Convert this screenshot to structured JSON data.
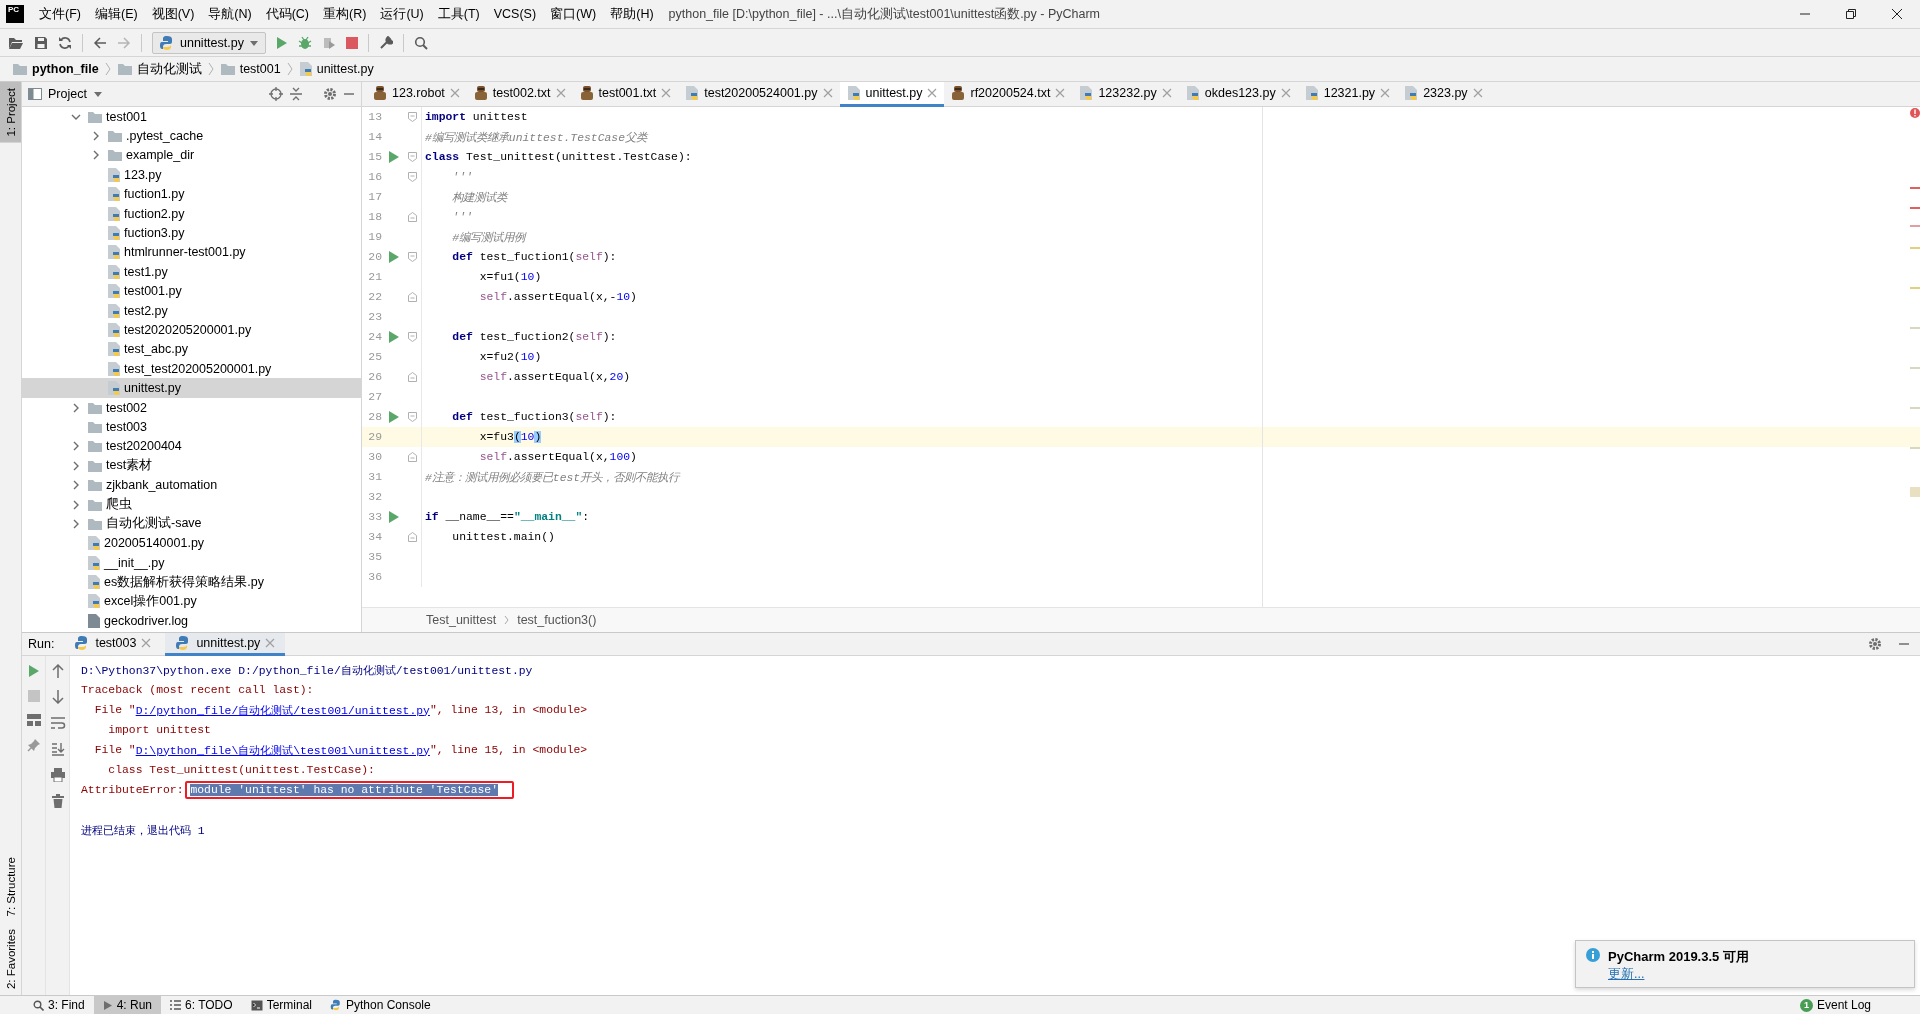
{
  "window": {
    "logo": "PC",
    "title": "python_file [D:\\python_file] - ...\\自动化测试\\test001\\unittest函数.py - PyCharm"
  },
  "menu": [
    "文件(F)",
    "编辑(E)",
    "视图(V)",
    "导航(N)",
    "代码(C)",
    "重构(R)",
    "运行(U)",
    "工具(T)",
    "VCS(S)",
    "窗口(W)",
    "帮助(H)"
  ],
  "toolbar": {
    "run_config": "unnittest.py"
  },
  "navigation": [
    "python_file",
    "自动化测试",
    "test001",
    "unittest.py"
  ],
  "side_stripe": [
    {
      "label": "1: Project",
      "selected": true
    },
    {
      "label": "7: Structure",
      "selected": false
    },
    {
      "label": "2: Favorites",
      "selected": false
    }
  ],
  "project": {
    "title": "Project",
    "tree": [
      {
        "name": "test001",
        "kind": "folder",
        "expanded": true,
        "selected": false,
        "children": [
          {
            "name": ".pytest_cache",
            "kind": "folder",
            "expanded": false,
            "selected": false
          },
          {
            "name": "example_dir",
            "kind": "folder",
            "expanded": false,
            "selected": false
          },
          {
            "name": "123.py",
            "kind": "python",
            "selected": false
          },
          {
            "name": "fuction1.py",
            "kind": "python",
            "selected": false
          },
          {
            "name": "fuction2.py",
            "kind": "python",
            "selected": false
          },
          {
            "name": "fuction3.py",
            "kind": "python",
            "selected": false
          },
          {
            "name": "htmlrunner-test001.py",
            "kind": "python",
            "selected": false
          },
          {
            "name": "test1.py",
            "kind": "python",
            "selected": false
          },
          {
            "name": "test001.py",
            "kind": "python",
            "selected": false
          },
          {
            "name": "test2.py",
            "kind": "python",
            "selected": false
          },
          {
            "name": "test2020205200001.py",
            "kind": "python",
            "selected": false
          },
          {
            "name": "test_abc.py",
            "kind": "python",
            "selected": false
          },
          {
            "name": "test_test202005200001.py",
            "kind": "python",
            "selected": false
          },
          {
            "name": "unittest.py",
            "kind": "python",
            "selected": true
          }
        ]
      },
      {
        "name": "test002",
        "kind": "folder",
        "expanded": false,
        "selected": false
      },
      {
        "name": "test003",
        "kind": "folder",
        "selected": false
      },
      {
        "name": "test20200404",
        "kind": "folder",
        "expanded": false,
        "selected": false
      },
      {
        "name": "test素材",
        "kind": "folder",
        "expanded": false,
        "selected": false
      },
      {
        "name": "zjkbank_automation",
        "kind": "folder",
        "expanded": false,
        "selected": false
      },
      {
        "name": "爬虫",
        "kind": "folder",
        "expanded": false,
        "selected": false
      },
      {
        "name": "自动化测试-save",
        "kind": "folder",
        "expanded": false,
        "selected": false
      },
      {
        "name": "202005140001.py",
        "kind": "python",
        "selected": false
      },
      {
        "name": "__init__.py",
        "kind": "python",
        "selected": false
      },
      {
        "name": "es数据解析获得策略结果.py",
        "kind": "python",
        "selected": false
      },
      {
        "name": "excel操作001.py",
        "kind": "python",
        "selected": false
      },
      {
        "name": "geckodriver.log",
        "kind": "log",
        "selected": false
      }
    ]
  },
  "editor": {
    "tabs": [
      {
        "label": "123.robot",
        "kind": "robot",
        "selected": false
      },
      {
        "label": "test002.txt",
        "kind": "robot",
        "selected": false
      },
      {
        "label": "test001.txt",
        "kind": "robot",
        "selected": false
      },
      {
        "label": "test20200524001.py",
        "kind": "python",
        "selected": false
      },
      {
        "label": "unittest.py",
        "kind": "python",
        "selected": true
      },
      {
        "label": "rf20200524.txt",
        "kind": "robot",
        "selected": false
      },
      {
        "label": "123232.py",
        "kind": "python",
        "selected": false
      },
      {
        "label": "okdes123.py",
        "kind": "python",
        "selected": false
      },
      {
        "label": "12321.py",
        "kind": "python",
        "selected": false
      },
      {
        "label": "2323.py",
        "kind": "python",
        "selected": false
      }
    ],
    "lines": [
      {
        "number": "13",
        "run": false,
        "fold_start": true,
        "fold_end": false,
        "current": false,
        "tokens": [
          {
            "kind": "keyword",
            "text": "import"
          },
          {
            "kind": "plain",
            "text": " unittest"
          }
        ]
      },
      {
        "number": "14",
        "run": false,
        "fold_start": false,
        "fold_end": false,
        "current": false,
        "tokens": [
          {
            "kind": "comment",
            "text": "#编写测试类继承unittest.TestCase父类"
          }
        ]
      },
      {
        "number": "15",
        "run": true,
        "fold_start": true,
        "fold_end": false,
        "current": false,
        "tokens": [
          {
            "kind": "keyword",
            "text": "class"
          },
          {
            "kind": "plain",
            "text": " Test_unittest(unittest.TestCase):"
          }
        ]
      },
      {
        "number": "16",
        "run": false,
        "fold_start": true,
        "fold_end": false,
        "current": false,
        "tokens": [
          {
            "kind": "comment",
            "text": "    '''"
          }
        ]
      },
      {
        "number": "17",
        "run": false,
        "fold_start": false,
        "fold_end": false,
        "current": false,
        "tokens": [
          {
            "kind": "comment",
            "text": "    构建测试类"
          }
        ]
      },
      {
        "number": "18",
        "run": false,
        "fold_start": false,
        "fold_end": true,
        "current": false,
        "tokens": [
          {
            "kind": "comment",
            "text": "    '''"
          }
        ]
      },
      {
        "number": "19",
        "run": false,
        "fold_start": false,
        "fold_end": false,
        "current": false,
        "tokens": [
          {
            "kind": "comment",
            "text": "    #编写测试用例"
          }
        ]
      },
      {
        "number": "20",
        "run": true,
        "fold_start": true,
        "fold_end": false,
        "current": false,
        "tokens": [
          {
            "kind": "keyword",
            "text": "    def"
          },
          {
            "kind": "plain",
            "text": " test_fuction1("
          },
          {
            "kind": "self",
            "text": "self"
          },
          {
            "kind": "plain",
            "text": "):"
          }
        ]
      },
      {
        "number": "21",
        "run": false,
        "fold_start": false,
        "fold_end": false,
        "current": false,
        "tokens": [
          {
            "kind": "plain",
            "text": "        x=fu1("
          },
          {
            "kind": "number",
            "text": "10"
          },
          {
            "kind": "plain",
            "text": ")"
          }
        ]
      },
      {
        "number": "22",
        "run": false,
        "fold_start": false,
        "fold_end": true,
        "current": false,
        "tokens": [
          {
            "kind": "self",
            "text": "        self"
          },
          {
            "kind": "plain",
            "text": ".assertEqual(x,-"
          },
          {
            "kind": "number",
            "text": "10"
          },
          {
            "kind": "plain",
            "text": ")"
          }
        ]
      },
      {
        "number": "23",
        "run": false,
        "fold_start": false,
        "fold_end": false,
        "current": false
      },
      {
        "number": "24",
        "run": true,
        "fold_start": true,
        "fold_end": false,
        "current": false,
        "tokens": [
          {
            "kind": "keyword",
            "text": "    def"
          },
          {
            "kind": "plain",
            "text": " test_fuction2("
          },
          {
            "kind": "self",
            "text": "self"
          },
          {
            "kind": "plain",
            "text": "):"
          }
        ]
      },
      {
        "number": "25",
        "run": false,
        "fold_start": false,
        "fold_end": false,
        "current": false,
        "tokens": [
          {
            "kind": "plain",
            "text": "        x=fu2("
          },
          {
            "kind": "number",
            "text": "10"
          },
          {
            "kind": "plain",
            "text": ")"
          }
        ]
      },
      {
        "number": "26",
        "run": false,
        "fold_start": false,
        "fold_end": true,
        "current": false,
        "tokens": [
          {
            "kind": "self",
            "text": "        self"
          },
          {
            "kind": "plain",
            "text": ".assertEqual(x,"
          },
          {
            "kind": "number",
            "text": "20"
          },
          {
            "kind": "plain",
            "text": ")"
          }
        ]
      },
      {
        "number": "27",
        "run": false,
        "fold_start": false,
        "fold_end": false,
        "current": false
      },
      {
        "number": "28",
        "run": true,
        "fold_start": true,
        "fold_end": false,
        "current": false,
        "tokens": [
          {
            "kind": "keyword",
            "text": "    def"
          },
          {
            "kind": "plain",
            "text": " test_fuction3("
          },
          {
            "kind": "self",
            "text": "self"
          },
          {
            "kind": "plain",
            "text": "):"
          }
        ]
      },
      {
        "number": "29",
        "run": false,
        "fold_start": false,
        "fold_end": false,
        "current": true,
        "tokens": [
          {
            "kind": "plain",
            "text": "        x=fu3"
          },
          {
            "kind": "bracket",
            "text": "("
          },
          {
            "kind": "number",
            "text": "10"
          },
          {
            "kind": "bracket",
            "text": ")"
          }
        ]
      },
      {
        "number": "30",
        "run": false,
        "fold_start": false,
        "fold_end": true,
        "current": false,
        "tokens": [
          {
            "kind": "self",
            "text": "        self"
          },
          {
            "kind": "plain",
            "text": ".assertEqual(x,"
          },
          {
            "kind": "number",
            "text": "100"
          },
          {
            "kind": "plain",
            "text": ")"
          }
        ]
      },
      {
        "number": "31",
        "run": false,
        "fold_start": false,
        "fold_end": false,
        "current": false,
        "tokens": [
          {
            "kind": "comment",
            "text": "#注意：测试用例必须要已test开头，否则不能执行"
          }
        ]
      },
      {
        "number": "32",
        "run": false,
        "fold_start": false,
        "fold_end": false,
        "current": false
      },
      {
        "number": "33",
        "run": true,
        "fold_start": false,
        "fold_end": false,
        "current": false,
        "tokens": [
          {
            "kind": "keyword",
            "text": "if"
          },
          {
            "kind": "plain",
            "text": " __name__=="
          },
          {
            "kind": "string",
            "text": "\"__main__\""
          },
          {
            "kind": "plain",
            "text": ":"
          }
        ]
      },
      {
        "number": "34",
        "run": false,
        "fold_start": false,
        "fold_end": true,
        "current": false,
        "tokens": [
          {
            "kind": "plain",
            "text": "    unittest.main()"
          }
        ]
      },
      {
        "number": "35",
        "run": false,
        "fold_start": false,
        "fold_end": false,
        "current": false
      },
      {
        "number": "36",
        "run": false,
        "fold_start": false,
        "fold_end": false,
        "current": false
      }
    ],
    "breadcrumb": [
      "Test_unittest",
      "test_fuction3()"
    ]
  },
  "run": {
    "label": "Run:",
    "tabs": [
      {
        "label": "test003",
        "selected": false
      },
      {
        "label": "unnittest.py",
        "selected": true
      }
    ],
    "console": [
      [
        {
          "kind": "command",
          "text": "D:\\Python37\\python.exe D:/python_file/自动化测试/test001/unittest.py"
        }
      ],
      [
        {
          "kind": "error",
          "text": "Traceback (most recent call last):"
        }
      ],
      [
        {
          "kind": "error",
          "text": "  File \""
        },
        {
          "kind": "link",
          "text": "D:/python_file/自动化测试/test001/unittest.py"
        },
        {
          "kind": "error",
          "text": "\", line 13, in <module>"
        }
      ],
      [
        {
          "kind": "error",
          "text": "    import unittest"
        }
      ],
      [
        {
          "kind": "error",
          "text": "  File \""
        },
        {
          "kind": "link",
          "text": "D:\\python_file\\自动化测试\\test001\\unittest.py"
        },
        {
          "kind": "error",
          "text": "\", line 15, in <module>"
        }
      ],
      [
        {
          "kind": "error",
          "text": "    class Test_unittest(unittest.TestCase):"
        }
      ],
      [
        {
          "kind": "error",
          "text": "AttributeError: "
        },
        {
          "kind": "selected",
          "text": "module 'unittest' has no attribute 'TestCase'"
        }
      ],
      [
        {
          "kind": "exit",
          "text": "进程已结束，退出代码 1"
        }
      ]
    ]
  },
  "notification": {
    "title": "PyCharm 2019.3.5 可用",
    "link": "更新..."
  },
  "status_bar": {
    "tools": [
      {
        "label": "3: Find",
        "kind": "find",
        "selected": false
      },
      {
        "label": "4: Run",
        "kind": "run",
        "selected": true
      },
      {
        "label": "6: TODO",
        "kind": "todo",
        "selected": false
      },
      {
        "label": "Terminal",
        "kind": "terminal",
        "selected": false
      },
      {
        "label": "Python Console",
        "kind": "console",
        "selected": false
      }
    ],
    "event_log": {
      "label": "Event Log",
      "count": "1"
    }
  }
}
